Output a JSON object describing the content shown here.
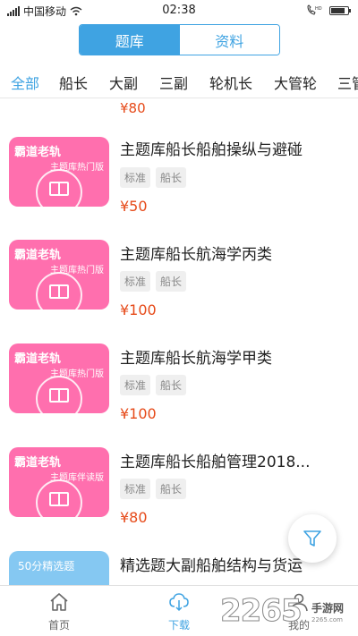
{
  "status_bar": {
    "carrier": "中国移动",
    "time": "02:38"
  },
  "segment": {
    "active_label": "题库",
    "inactive_label": "资料"
  },
  "tabs": [
    "全部",
    "船长",
    "大副",
    "三副",
    "轮机长",
    "大管轮",
    "三管"
  ],
  "active_tab": "全部",
  "list": {
    "partial_top_price": "¥80",
    "items": [
      {
        "thumb_brand": "霸道老轨",
        "thumb_sub": "主题库热门版",
        "title": "主题库船长船舶操纵与避碰",
        "tags": [
          "标准",
          "船长"
        ],
        "price": "¥50"
      },
      {
        "thumb_brand": "霸道老轨",
        "thumb_sub": "主题库热门版",
        "title": "主题库船长航海学丙类",
        "tags": [
          "标准",
          "船长"
        ],
        "price": "¥100"
      },
      {
        "thumb_brand": "霸道老轨",
        "thumb_sub": "主题库热门版",
        "title": "主题库船长航海学甲类",
        "tags": [
          "标准",
          "船长"
        ],
        "price": "¥100"
      },
      {
        "thumb_brand": "霸道老轨",
        "thumb_sub": "主题库伴读版",
        "title": "主题库船长船舶管理2018...",
        "tags": [
          "标准",
          "船长"
        ],
        "price": "¥80"
      }
    ],
    "partial_bottom": {
      "thumb_label": "50分精选题",
      "title": "精选题大副船舶结构与货运"
    }
  },
  "bottom_nav": [
    {
      "label": "首页",
      "icon": "home-icon"
    },
    {
      "label": "下载",
      "icon": "download-icon"
    },
    {
      "label": "我的",
      "icon": "profile-icon"
    }
  ],
  "active_nav": "下载",
  "watermark": {
    "number": "2265",
    "text": "手游网",
    "url": "2265.com"
  },
  "colors": {
    "accent": "#3fa3e2",
    "price": "#e64a19",
    "thumb_pink": "#ff6fae"
  }
}
